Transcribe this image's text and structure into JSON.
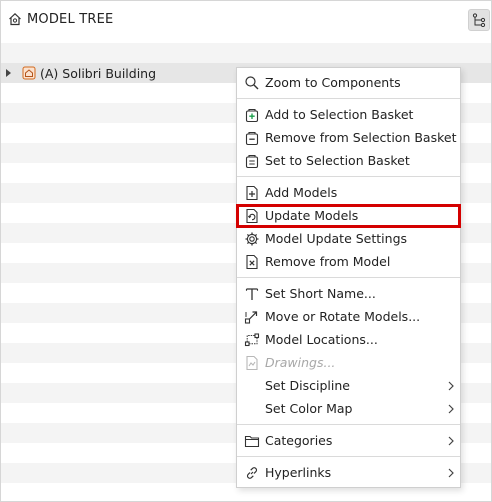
{
  "panel": {
    "title": "MODEL TREE",
    "icon": "home-icon",
    "toolbar_icon": "hierarchy-icon"
  },
  "tree": {
    "root_label": "(A) Solibri Building",
    "root_icon": "building-icon"
  },
  "menu": {
    "items": [
      {
        "label": "Zoom to Components",
        "icon": "search-icon"
      },
      {
        "label": "Add to Selection Basket",
        "icon": "basket-add-icon"
      },
      {
        "label": "Remove from Selection Basket",
        "icon": "basket-remove-icon"
      },
      {
        "label": "Set to Selection Basket",
        "icon": "basket-set-icon"
      },
      {
        "label": "Add Models",
        "icon": "add-file-icon"
      },
      {
        "label": "Update Models",
        "icon": "update-file-icon"
      },
      {
        "label": "Model Update Settings",
        "icon": "gear-icon"
      },
      {
        "label": "Remove from Model",
        "icon": "remove-file-icon"
      },
      {
        "label": "Set Short Name...",
        "icon": "text-icon"
      },
      {
        "label": "Move or Rotate Models...",
        "icon": "move-icon"
      },
      {
        "label": "Model Locations...",
        "icon": "location-icon"
      },
      {
        "label": "Drawings...",
        "icon": "drawing-icon"
      },
      {
        "label": "Set Discipline",
        "icon": ""
      },
      {
        "label": "Set Color Map",
        "icon": ""
      },
      {
        "label": "Categories",
        "icon": "folder-icon"
      },
      {
        "label": "Hyperlinks",
        "icon": "link-icon"
      }
    ]
  },
  "colors": {
    "highlight": "#d40000",
    "selected_row": "#e6e6e6",
    "stripe": "#f4f4f4"
  }
}
